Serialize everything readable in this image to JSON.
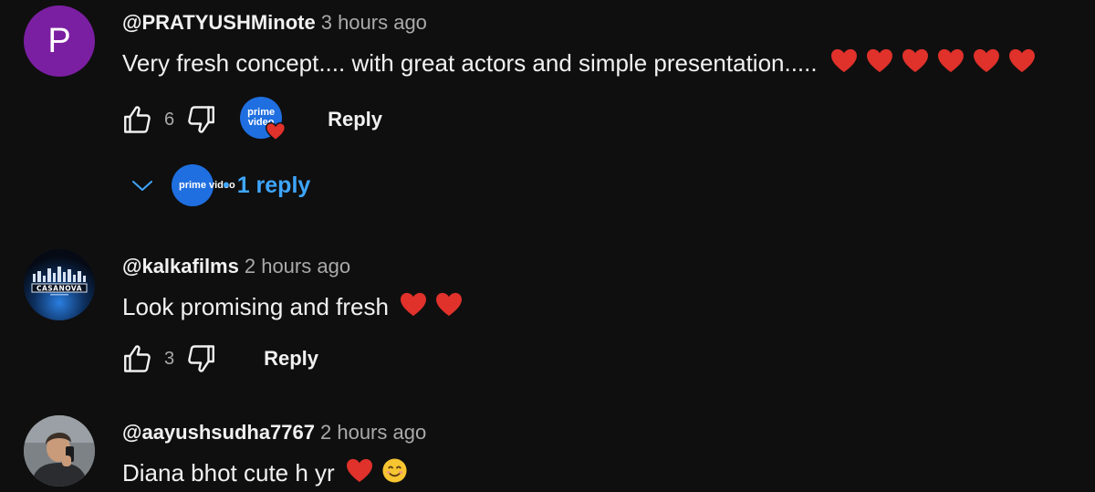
{
  "comments": [
    {
      "avatar_letter": "P",
      "avatar_color": "#7b1fa2",
      "author": "@PRATYUSHMinote",
      "time": "3 hours ago",
      "text": "Very fresh concept.... with great actors and simple presentation.....",
      "emojis": [
        "red-heart",
        "red-heart",
        "red-heart",
        "red-heart",
        "red-heart",
        "red-heart"
      ],
      "likes": "6",
      "creator_heart": true,
      "creator_badge_text": "prime video",
      "reply_label": "Reply",
      "replies_label": "1 reply",
      "replies_avatar_text": "prime video"
    },
    {
      "avatar_image": "casanova-logo",
      "avatar_text": "CASANOVA",
      "author": "@kalkafilms",
      "time": "2 hours ago",
      "text": "Look promising and fresh",
      "emojis": [
        "red-heart",
        "red-heart"
      ],
      "likes": "3",
      "reply_label": "Reply"
    },
    {
      "avatar_image": "user-photo",
      "author": "@aayushsudha7767",
      "time": "2 hours ago",
      "text": "Diana bhot cute h yr",
      "emojis": [
        "red-heart",
        "smiling-face"
      ]
    }
  ],
  "colors": {
    "background": "#0f0f0f",
    "text": "#f1f1f1",
    "secondary": "#aaaaaa",
    "link": "#3ea6ff",
    "heart": "#e0312b",
    "prime_blue": "#1f6fe0"
  }
}
